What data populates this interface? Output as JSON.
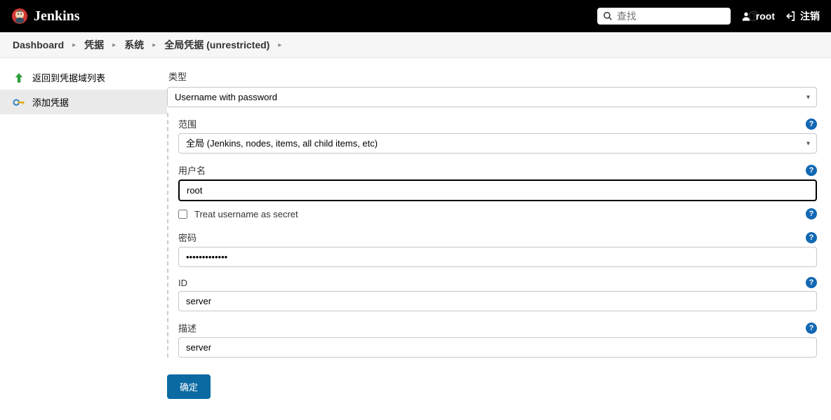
{
  "header": {
    "brand": "Jenkins",
    "search_placeholder": "查找",
    "username": "root",
    "logout": "注销"
  },
  "breadcrumb": {
    "items": [
      "Dashboard",
      "凭据",
      "系统",
      "全局凭据 (unrestricted)"
    ]
  },
  "sidebar": {
    "back": "返回到凭据域列表",
    "add": "添加凭据"
  },
  "form": {
    "type_label": "类型",
    "type_value": "Username with password",
    "scope_label": "范围",
    "scope_value": "全局 (Jenkins, nodes, items, all child items, etc)",
    "username_label": "用户名",
    "username_value": "root",
    "treat_label": "Treat username as secret",
    "password_label": "密码",
    "password_value": "•••••••••••••",
    "id_label": "ID",
    "id_value": "server",
    "desc_label": "描述",
    "desc_value": "server",
    "submit": "确定"
  }
}
